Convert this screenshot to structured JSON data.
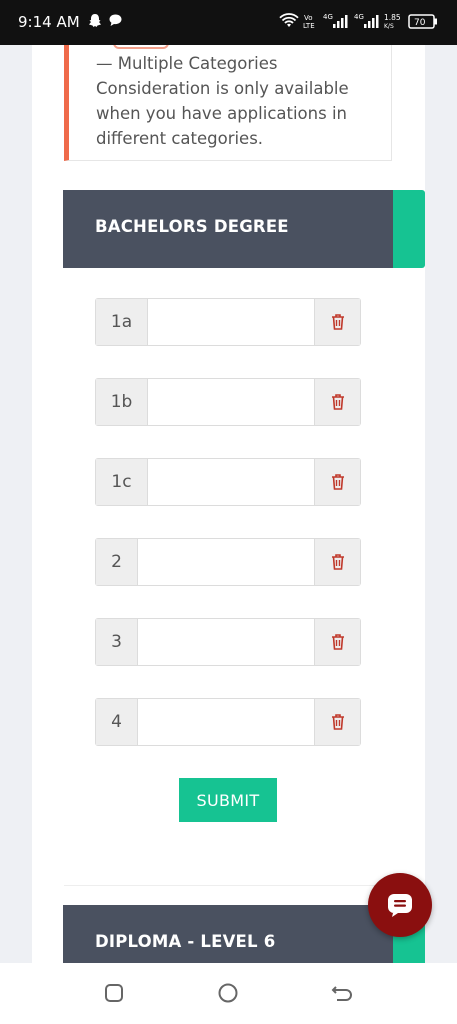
{
  "status_bar": {
    "time": "9:14 AM",
    "network_label": "4G",
    "speed_value": "1.85",
    "speed_unit": "K/S",
    "battery": "70",
    "icons": [
      "snapchat-icon",
      "chat-bubble-icon",
      "wifi-icon",
      "volte-icon",
      "signal-icon",
      "signal-icon",
      "battery-icon"
    ]
  },
  "note": {
    "text": "— Multiple Categories Consideration is only available when you have applications in different categories."
  },
  "sections": [
    {
      "title": "BACHELORS DEGREE",
      "rows": [
        {
          "label": "1a",
          "value": ""
        },
        {
          "label": "1b",
          "value": ""
        },
        {
          "label": "1c",
          "value": ""
        },
        {
          "label": "2",
          "value": ""
        },
        {
          "label": "3",
          "value": ""
        },
        {
          "label": "4",
          "value": ""
        }
      ],
      "submit_label": "SUBMIT"
    },
    {
      "title": "DIPLOMA - LEVEL 6"
    }
  ],
  "colors": {
    "header_bg": "#4a5160",
    "accent_green": "#16c392",
    "delete_red": "#c0392b",
    "note_border": "#ef6a4a",
    "chat_button": "#8a0f0f"
  }
}
